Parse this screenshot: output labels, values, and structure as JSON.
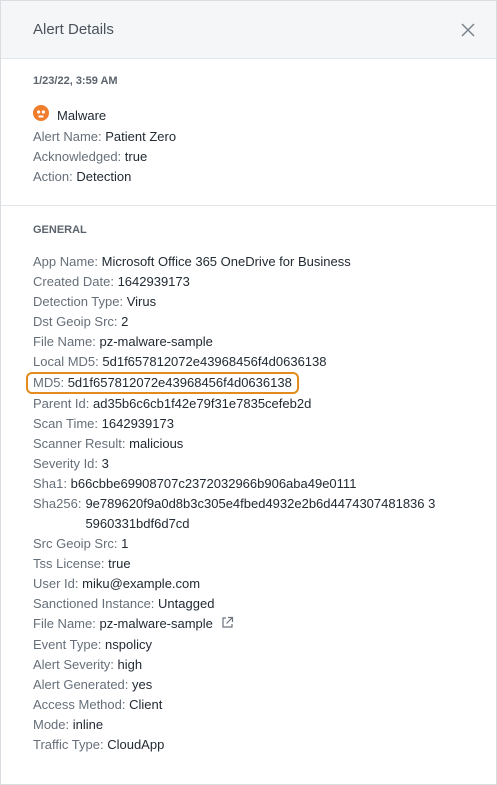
{
  "header": {
    "title": "Alert Details",
    "close_icon": "close-icon"
  },
  "summary": {
    "timestamp": "1/23/22, 3:59 AM",
    "type": "Malware",
    "type_icon": "skull-icon",
    "fields": [
      {
        "label": "Alert Name:",
        "value": "Patient Zero"
      },
      {
        "label": "Acknowledged:",
        "value": "true"
      },
      {
        "label": "Action:",
        "value": "Detection"
      }
    ]
  },
  "general": {
    "heading": "GENERAL",
    "fields": [
      {
        "label": "App Name:",
        "value": "Microsoft Office 365 OneDrive for Business"
      },
      {
        "label": "Created Date:",
        "value": "1642939173"
      },
      {
        "label": "Detection Type:",
        "value": "Virus"
      },
      {
        "label": "Dst Geoip Src:",
        "value": "2"
      },
      {
        "label": "File Name:",
        "value": "pz-malware-sample"
      },
      {
        "label": "Local MD5:",
        "value": "5d1f657812072e43968456f4d0636138"
      },
      {
        "label": "MD5:",
        "value": "5d1f657812072e43968456f4d0636138"
      },
      {
        "label": "Parent Id:",
        "value": "ad35b6c6cb1f42e79f31e7835cefeb2d"
      },
      {
        "label": "Scan Time:",
        "value": "1642939173"
      },
      {
        "label": "Scanner Result:",
        "value": "malicious"
      },
      {
        "label": "Severity Id:",
        "value": "3"
      },
      {
        "label": "Sha1:",
        "value": "b66cbbe69908707c2372032966b906aba49e0111"
      },
      {
        "label": "Sha256:",
        "value": "9e789620f9a0d8b3c305e4fbed4932e2b6d4474307481836 35960331bdf6d7cd"
      },
      {
        "label": "Src Geoip Src:",
        "value": "1"
      },
      {
        "label": "Tss License:",
        "value": "true"
      },
      {
        "label": "User Id:",
        "value": "miku@example.com"
      },
      {
        "label": "Sanctioned Instance:",
        "value": "Untagged"
      },
      {
        "label": "File Name:",
        "value": "pz-malware-sample"
      },
      {
        "label": "Event Type:",
        "value": "nspolicy"
      },
      {
        "label": "Alert Severity:",
        "value": "high"
      },
      {
        "label": "Alert Generated:",
        "value": "yes"
      },
      {
        "label": "Access Method:",
        "value": "Client"
      },
      {
        "label": "Mode:",
        "value": "inline"
      },
      {
        "label": "Traffic Type:",
        "value": "CloudApp"
      }
    ]
  },
  "colors": {
    "highlight": "#e38b1d",
    "malware_icon": "#f07d2c"
  }
}
